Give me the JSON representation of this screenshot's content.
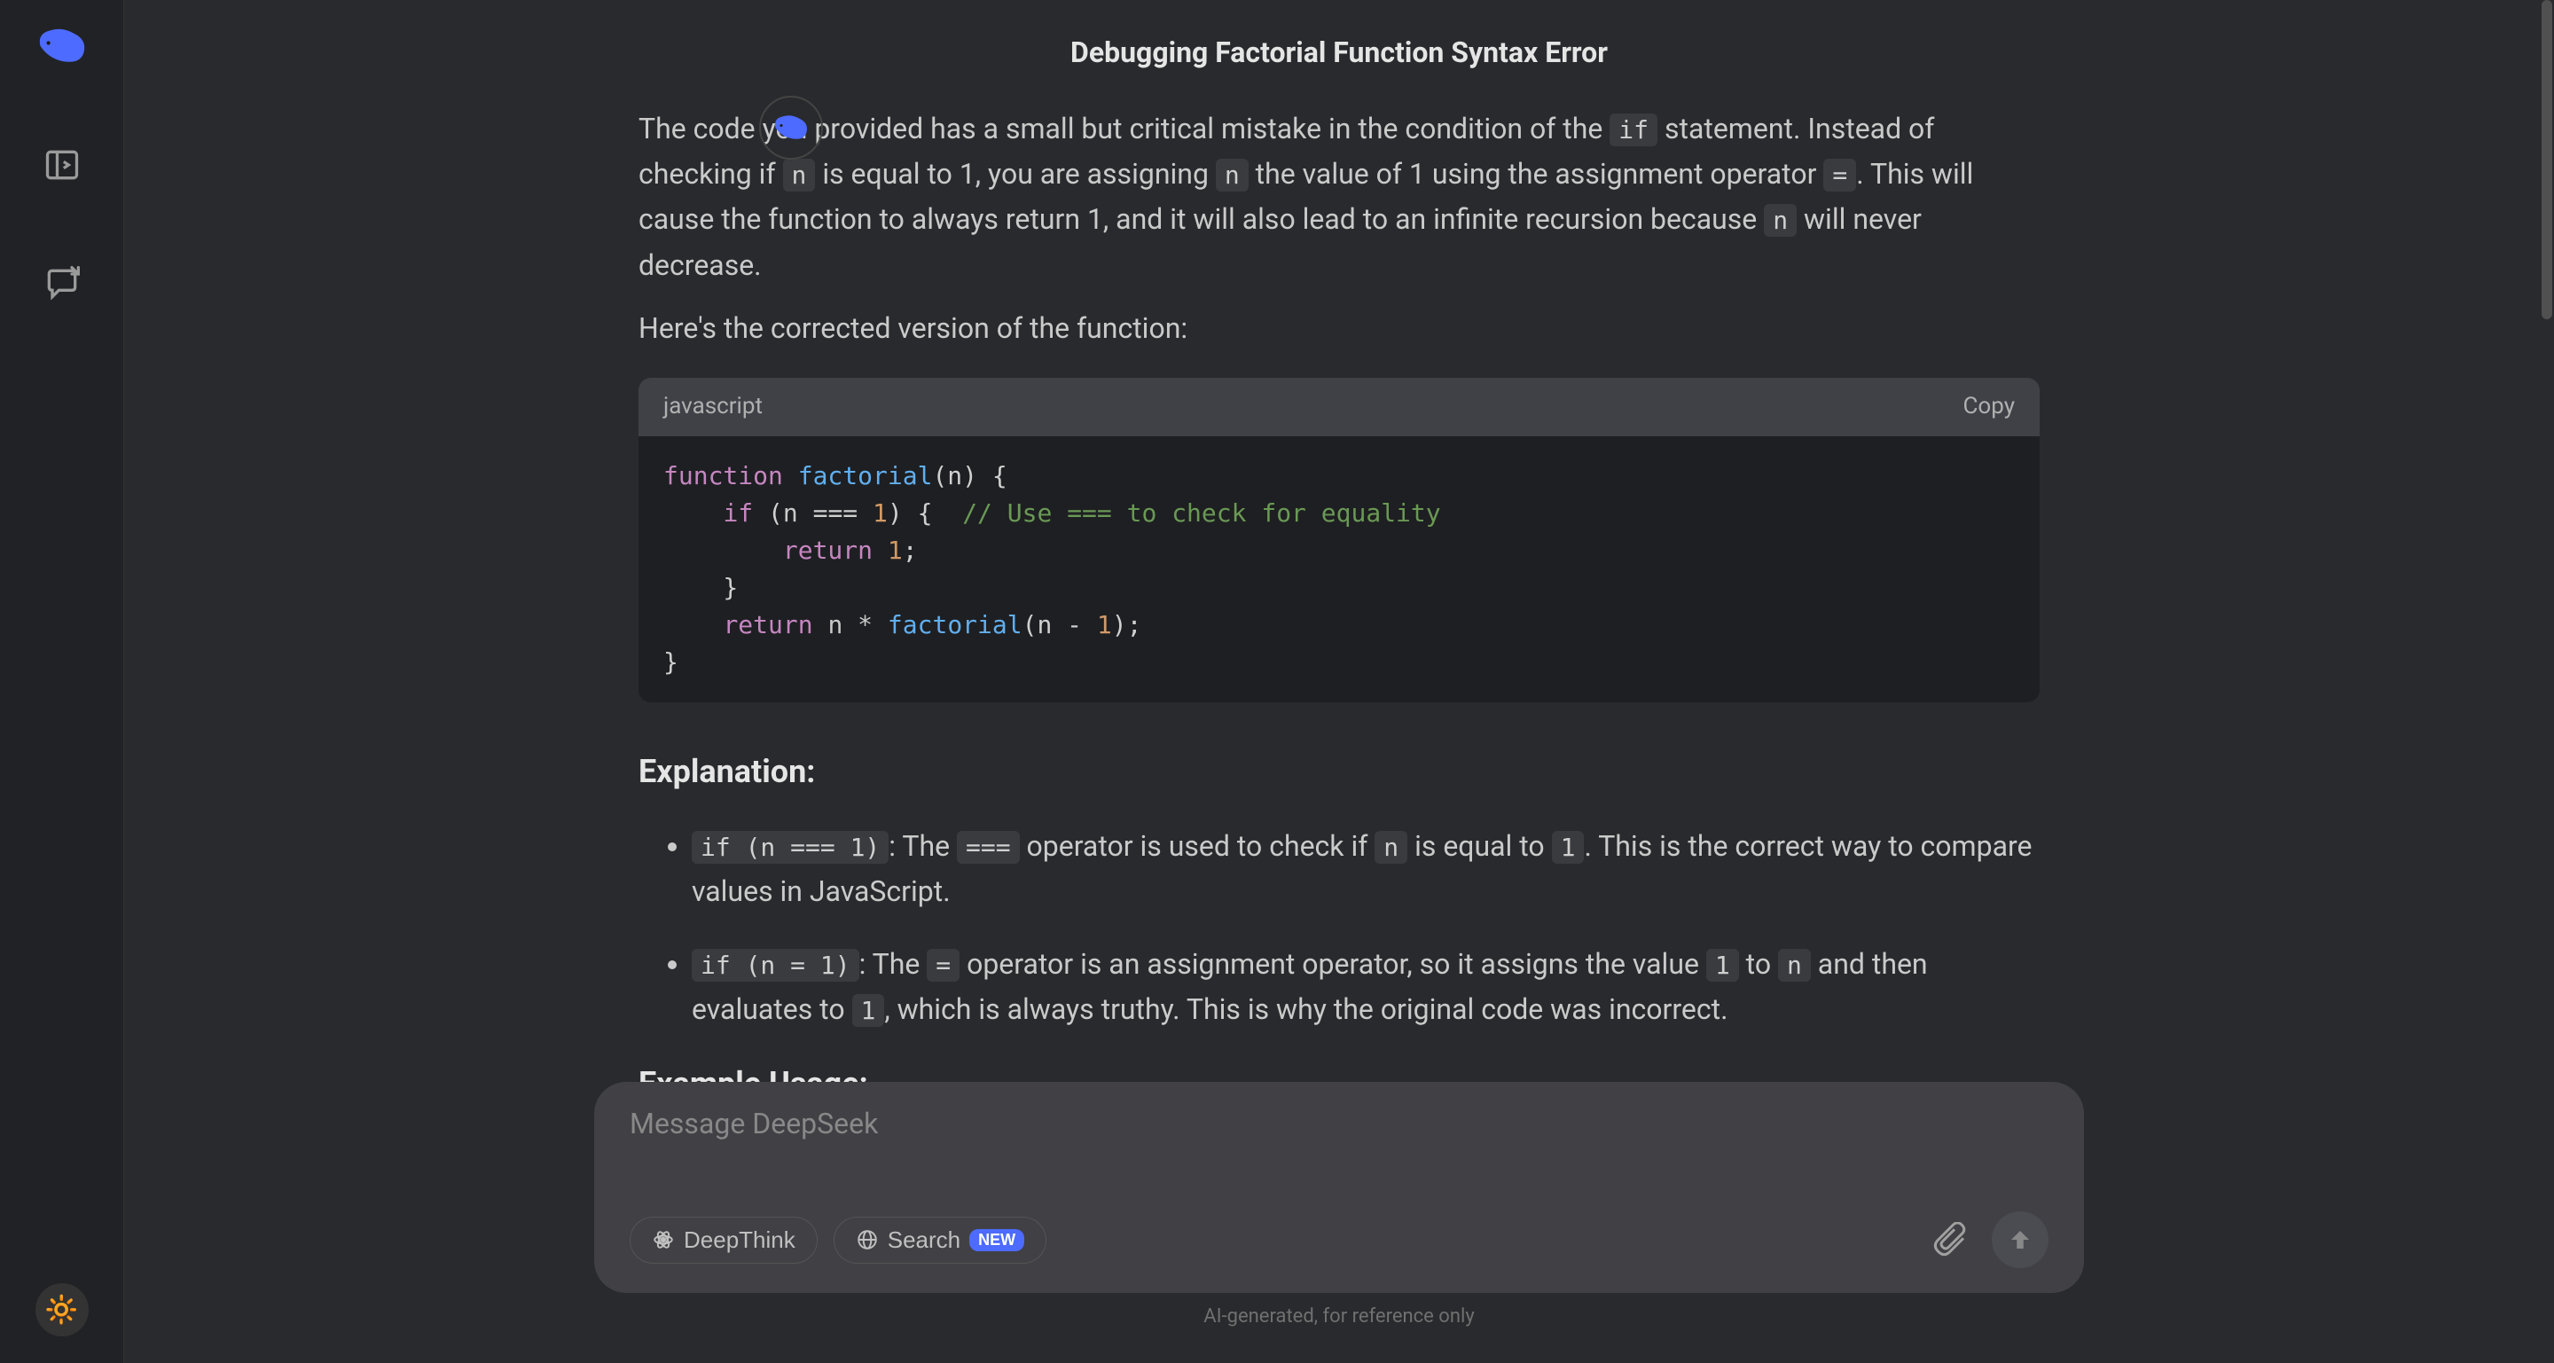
{
  "title": "Debugging Factorial Function Syntax Error",
  "paragraph1": {
    "t1": "The code you provided has a small but critical mistake in the condition of the ",
    "c1": "if",
    "t2": " statement. Instead of checking if ",
    "c2": "n",
    "t3": " is equal to 1, you are assigning ",
    "c3": "n",
    "t4": " the value of 1 using the assignment operator ",
    "c4": "=",
    "t5": ". This will cause the function to always return 1, and it will also lead to an infinite recursion because ",
    "c5": "n",
    "t6": " will never decrease."
  },
  "paragraph2": "Here's the corrected version of the function:",
  "code": {
    "lang": "javascript",
    "copy": "Copy",
    "kw_function": "function",
    "fn_factorial": "factorial",
    "paren_open": "(",
    "param_n": "n",
    "paren_close_brace": ") {",
    "indent1": "    ",
    "kw_if": "if",
    "sp_paren": " (",
    "eq_op": " === ",
    "num_1a": "1",
    "close_brace2": ") {  ",
    "comment": "// Use === to check for equality",
    "indent2": "        ",
    "kw_return1": "return",
    "sp": " ",
    "num_1b": "1",
    "semi": ";",
    "close_brace_indent": "    }",
    "kw_return2": "return",
    "sp_nstar": " n * ",
    "fn_factorial2": "factorial",
    "paren2": "(n - ",
    "num_1c": "1",
    "close_call": ");",
    "close_fn": "}"
  },
  "explanation_heading": "Explanation:",
  "bullet1": {
    "c1": "if (n === 1)",
    "t1": ": The ",
    "c2": "===",
    "t2": " operator is used to check if ",
    "c3": "n",
    "t3": " is equal to ",
    "c4": "1",
    "t4": ". This is the correct way to compare values in JavaScript."
  },
  "bullet2": {
    "c1": "if (n = 1)",
    "t1": ": The ",
    "c2": "=",
    "t2": " operator is an assignment operator, so it assigns the value ",
    "c3": "1",
    "t3": " to ",
    "c4": "n",
    "t4": " and then evaluates to ",
    "c5": "1",
    "t5": ", which is always truthy. This is why the original code was incorrect."
  },
  "usage_heading": "Example Usage:",
  "input": {
    "placeholder": "Message DeepSeek",
    "deepthink": "DeepThink",
    "search": "Search",
    "new_badge": "NEW"
  },
  "disclaimer": "AI-generated, for reference only"
}
